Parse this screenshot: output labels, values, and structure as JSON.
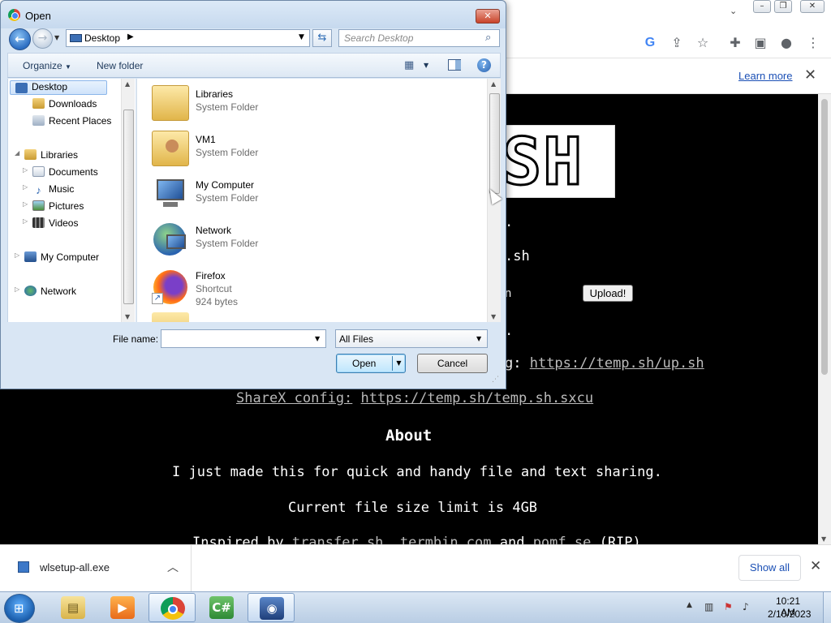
{
  "browser": {
    "toolbar_icons": [
      "google-icon",
      "share-icon",
      "star-icon",
      "extensions-icon",
      "sidepanel-icon",
      "profile-icon",
      "menu-icon"
    ],
    "infobar": {
      "learn_more": "Learn more"
    }
  },
  "page": {
    "logo_text": "SH",
    "frag_line1": ".",
    "frag_line2": ".sh",
    "frag_line3": "n",
    "frag_line4": ".",
    "upload_button": "Upload!",
    "curl_prefix": "g: ",
    "curl_link": "https://temp.sh/up.sh",
    "sharex_label": "ShareX config:",
    "sharex_link": "https://temp.sh/temp.sh.sxcu",
    "about_heading": "About",
    "about_text": "I just made this for quick and handy file and text sharing.",
    "limit_text": "Current file size limit is 4GB",
    "inspired_prefix": "Inspired by ",
    "inspired_link1": "transfer.sh",
    "inspired_sep": ", ",
    "inspired_link2": "termbin.com",
    "inspired_and": " and ",
    "inspired_link3": "pomf.se",
    "inspired_suffix": " (RIP)"
  },
  "download_bar": {
    "file_name": "wlsetup-all.exe",
    "show_all": "Show all"
  },
  "taskbar": {
    "apps": [
      "explorer-icon",
      "media-player-icon",
      "chrome-icon",
      "csharp-icon",
      "remote-app-icon"
    ],
    "time": "10:21 AM",
    "date": "2/10/2023"
  },
  "dialog": {
    "title": "Open",
    "address": "Desktop",
    "search_placeholder": "Search Desktop",
    "organize": "Organize",
    "new_folder": "New folder",
    "nav": {
      "desktop": "Desktop",
      "downloads": "Downloads",
      "recent": "Recent Places",
      "libraries": "Libraries",
      "documents": "Documents",
      "music": "Music",
      "pictures": "Pictures",
      "videos": "Videos",
      "my_computer": "My Computer",
      "network": "Network"
    },
    "files": [
      {
        "name": "Libraries",
        "type": "System Folder"
      },
      {
        "name": "VM1",
        "type": "System Folder"
      },
      {
        "name": "My Computer",
        "type": "System Folder"
      },
      {
        "name": "Network",
        "type": "System Folder"
      },
      {
        "name": "Firefox",
        "type": "Shortcut",
        "size": "924 bytes"
      }
    ],
    "file_name_label": "File name:",
    "file_name_value": "",
    "filter": "All Files",
    "open_button": "Open",
    "cancel_button": "Cancel"
  }
}
